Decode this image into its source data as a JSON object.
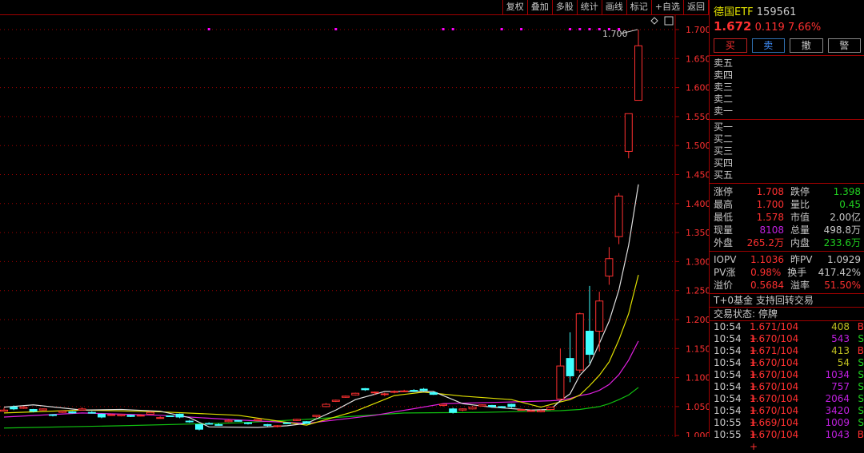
{
  "toolbar": {
    "buttons": [
      "复权",
      "叠加",
      "多股",
      "统计",
      "画线",
      "标记",
      "+自选",
      "返回"
    ]
  },
  "header": {
    "name": "德国ETF",
    "code": "159561",
    "price": "1.672",
    "change": "0.119",
    "pct": "7.66%"
  },
  "actions": [
    "买",
    "卖",
    "撤",
    "警"
  ],
  "sell": [
    "卖五",
    "卖四",
    "卖三",
    "卖二",
    "卖一"
  ],
  "buy": [
    "买一",
    "买二",
    "买三",
    "买四",
    "买五"
  ],
  "stats": [
    {
      "k": "涨停",
      "v": "1.708",
      "vc": "red",
      "k2": "跌停",
      "v2": "1.398",
      "v2c": "grn"
    },
    {
      "k": "最高",
      "v": "1.700",
      "vc": "red",
      "k2": "量比",
      "v2": "0.45",
      "v2c": "grn"
    },
    {
      "k": "最低",
      "v": "1.578",
      "vc": "red",
      "k2": "市值",
      "v2": "2.00亿",
      "v2c": ""
    },
    {
      "k": "现量",
      "v": "8108",
      "vc": "pur",
      "k2": "总量",
      "v2": "498.8万",
      "v2c": ""
    },
    {
      "k": "外盘",
      "v": "265.2万",
      "vc": "red",
      "k2": "内盘",
      "v2": "233.6万",
      "v2c": "grn"
    }
  ],
  "iopv": [
    {
      "k": "IOPV",
      "v": "1.1036",
      "vc": "red",
      "k2": "昨PV",
      "v2": "1.0929",
      "v2c": ""
    },
    {
      "k": "PV涨",
      "v": "0.98%",
      "vc": "red",
      "k2": "换手",
      "v2": "417.42%",
      "v2c": ""
    },
    {
      "k": "溢价",
      "v": "0.5684",
      "vc": "red",
      "k2": "溢率",
      "v2": "51.50%",
      "v2c": "red"
    }
  ],
  "t0": "T+0基金 支持回转交易",
  "status": "交易状态: 停牌",
  "ticks": [
    {
      "t": "10:54",
      "p": "1.671/104 +",
      "v": "408",
      "vc": "yel",
      "s": "B"
    },
    {
      "t": "10:54",
      "p": "1.670/104 +",
      "v": "543",
      "vc": "pur",
      "s": "S"
    },
    {
      "t": "10:54",
      "p": "1.671/104 +",
      "v": "413",
      "vc": "yel",
      "s": "B"
    },
    {
      "t": "10:54",
      "p": "1.670/104 +",
      "v": "54",
      "vc": "yel",
      "s": "S"
    },
    {
      "t": "10:54",
      "p": "1.670/104 +",
      "v": "1034",
      "vc": "pur",
      "s": "S"
    },
    {
      "t": "10:54",
      "p": "1.670/104 +",
      "v": "757",
      "vc": "pur",
      "s": "S"
    },
    {
      "t": "10:54",
      "p": "1.670/104 +",
      "v": "2064",
      "vc": "pur",
      "s": "S"
    },
    {
      "t": "10:54",
      "p": "1.670/104 +",
      "v": "3420",
      "vc": "pur",
      "s": "S"
    },
    {
      "t": "10:55",
      "p": "1.669/104 +",
      "v": "1009",
      "vc": "pur",
      "s": "S"
    },
    {
      "t": "10:55",
      "p": "1.670/104 +",
      "v": "1043",
      "vc": "pur",
      "s": "B"
    }
  ],
  "chart_data": {
    "type": "candlestick",
    "ylim": [
      1.0,
      1.72
    ],
    "yticks": [
      "1.700",
      "1.650",
      "1.600",
      "1.550",
      "1.500",
      "1.450",
      "1.400",
      "1.350",
      "1.300",
      "1.250",
      "1.200",
      "1.150",
      "1.100",
      "1.050",
      "1.000"
    ],
    "high_label": "1.700",
    "colors": {
      "up": "#ff3030",
      "down": "#40ffff",
      "ma5": "#e0e0e0",
      "ma10": "#e0e000",
      "ma20": "#e020e0",
      "ma60": "#10c010",
      "grid": "#a00000",
      "marker": "#ff00ff"
    },
    "ohlc": [
      [
        1.042,
        1.048,
        1.041,
        1.044
      ],
      [
        1.049,
        1.052,
        1.044,
        1.046
      ],
      [
        1.047,
        1.051,
        1.046,
        1.049
      ],
      [
        1.045,
        1.046,
        1.04,
        1.042
      ],
      [
        1.044,
        1.047,
        1.043,
        1.046
      ],
      [
        1.036,
        1.037,
        1.033,
        1.035
      ],
      [
        1.04,
        1.043,
        1.039,
        1.042
      ],
      [
        1.041,
        1.042,
        1.038,
        1.039
      ],
      [
        1.044,
        1.049,
        1.043,
        1.046
      ],
      [
        1.04,
        1.042,
        1.038,
        1.039
      ],
      [
        1.037,
        1.038,
        1.03,
        1.032
      ],
      [
        1.035,
        1.038,
        1.034,
        1.036
      ],
      [
        1.034,
        1.037,
        1.033,
        1.036
      ],
      [
        1.035,
        1.036,
        1.032,
        1.033
      ],
      [
        1.034,
        1.037,
        1.033,
        1.035
      ],
      [
        1.037,
        1.042,
        1.036,
        1.04
      ],
      [
        1.031,
        1.033,
        1.029,
        1.031
      ],
      [
        1.034,
        1.035,
        1.032,
        1.033
      ],
      [
        1.037,
        1.038,
        1.03,
        1.032
      ],
      [
        1.025,
        1.027,
        1.022,
        1.024
      ],
      [
        1.019,
        1.02,
        1.009,
        1.011
      ],
      [
        1.021,
        1.023,
        1.019,
        1.02
      ],
      [
        1.019,
        1.021,
        1.017,
        1.018
      ],
      [
        1.024,
        1.028,
        1.023,
        1.026
      ],
      [
        1.026,
        1.027,
        1.024,
        1.025
      ],
      [
        1.022,
        1.023,
        1.019,
        1.021
      ],
      [
        1.026,
        1.029,
        1.025,
        1.028
      ],
      [
        1.019,
        1.02,
        1.016,
        1.018
      ],
      [
        1.016,
        1.018,
        1.014,
        1.017
      ],
      [
        1.022,
        1.023,
        1.02,
        1.021
      ],
      [
        1.026,
        1.029,
        1.025,
        1.028
      ],
      [
        1.024,
        1.025,
        1.02,
        1.021
      ],
      [
        1.033,
        1.035,
        1.031,
        1.035
      ],
      [
        1.05,
        1.056,
        1.049,
        1.054
      ],
      [
        1.059,
        1.062,
        1.058,
        1.061
      ],
      [
        1.066,
        1.069,
        1.065,
        1.068
      ],
      [
        1.07,
        1.074,
        1.069,
        1.073
      ],
      [
        1.081,
        1.082,
        1.077,
        1.079
      ],
      [
        1.074,
        1.076,
        1.07,
        1.075
      ],
      [
        1.071,
        1.074,
        1.068,
        1.072
      ],
      [
        1.075,
        1.078,
        1.073,
        1.076
      ],
      [
        1.076,
        1.079,
        1.075,
        1.077
      ],
      [
        1.078,
        1.08,
        1.075,
        1.077
      ],
      [
        1.08,
        1.082,
        1.076,
        1.078
      ],
      [
        1.074,
        1.076,
        1.07,
        1.071
      ],
      [
        1.052,
        1.055,
        1.05,
        1.054
      ],
      [
        1.046,
        1.048,
        1.038,
        1.04
      ],
      [
        1.044,
        1.047,
        1.042,
        1.046
      ],
      [
        1.046,
        1.051,
        1.045,
        1.049
      ],
      [
        1.051,
        1.054,
        1.05,
        1.053
      ],
      [
        1.052,
        1.053,
        1.048,
        1.05
      ],
      [
        1.05,
        1.051,
        1.047,
        1.049
      ],
      [
        1.054,
        1.055,
        1.048,
        1.05
      ],
      [
        1.044,
        1.046,
        1.043,
        1.045
      ],
      [
        1.042,
        1.045,
        1.041,
        1.043
      ],
      [
        1.041,
        1.045,
        1.04,
        1.043
      ],
      [
        1.045,
        1.05,
        1.044,
        1.049
      ],
      [
        1.063,
        1.15,
        1.06,
        1.12
      ],
      [
        1.133,
        1.178,
        1.092,
        1.103
      ],
      [
        1.113,
        1.212,
        1.108,
        1.21
      ],
      [
        1.18,
        1.258,
        1.125,
        1.14
      ],
      [
        1.18,
        1.248,
        1.145,
        1.232
      ],
      [
        1.275,
        1.325,
        1.26,
        1.305
      ],
      [
        1.343,
        1.418,
        1.33,
        1.413
      ],
      [
        1.49,
        1.555,
        1.478,
        1.555
      ],
      [
        1.578,
        1.7,
        1.578,
        1.672
      ]
    ],
    "ma": {
      "ma5": [
        [
          0,
          1.049
        ],
        [
          3,
          1.053
        ],
        [
          8,
          1.044
        ],
        [
          12,
          1.045
        ],
        [
          16,
          1.042
        ],
        [
          19,
          1.031
        ],
        [
          21,
          1.015
        ],
        [
          26,
          1.014
        ],
        [
          29,
          1.017
        ],
        [
          31,
          1.021
        ],
        [
          34,
          1.044
        ],
        [
          36,
          1.062
        ],
        [
          39,
          1.076
        ],
        [
          44,
          1.076
        ],
        [
          47,
          1.055
        ],
        [
          50,
          1.049
        ],
        [
          54,
          1.044
        ],
        [
          56,
          1.045
        ],
        [
          57,
          1.06
        ],
        [
          58,
          1.072
        ],
        [
          59,
          1.104
        ],
        [
          60,
          1.122
        ],
        [
          61,
          1.159
        ],
        [
          62,
          1.197
        ],
        [
          63,
          1.251
        ],
        [
          64,
          1.328
        ],
        [
          65,
          1.433
        ]
      ],
      "ma10": [
        [
          0,
          1.039
        ],
        [
          8,
          1.044
        ],
        [
          16,
          1.041
        ],
        [
          24,
          1.035
        ],
        [
          31,
          1.018
        ],
        [
          36,
          1.042
        ],
        [
          40,
          1.069
        ],
        [
          43,
          1.075
        ],
        [
          47,
          1.068
        ],
        [
          52,
          1.062
        ],
        [
          55,
          1.049
        ],
        [
          57,
          1.058
        ],
        [
          58,
          1.062
        ],
        [
          59,
          1.07
        ],
        [
          60,
          1.086
        ],
        [
          61,
          1.104
        ],
        [
          62,
          1.127
        ],
        [
          63,
          1.165
        ],
        [
          64,
          1.21
        ],
        [
          65,
          1.277
        ]
      ],
      "ma20": [
        [
          0,
          1.032
        ],
        [
          8,
          1.039
        ],
        [
          16,
          1.035
        ],
        [
          24,
          1.027
        ],
        [
          31,
          1.021
        ],
        [
          38,
          1.035
        ],
        [
          45,
          1.055
        ],
        [
          52,
          1.058
        ],
        [
          56,
          1.06
        ],
        [
          57,
          1.061
        ],
        [
          58,
          1.064
        ],
        [
          59,
          1.069
        ],
        [
          60,
          1.072
        ],
        [
          61,
          1.078
        ],
        [
          62,
          1.088
        ],
        [
          63,
          1.105
        ],
        [
          64,
          1.13
        ],
        [
          65,
          1.163
        ]
      ],
      "ma60": [
        [
          0,
          1.013
        ],
        [
          12,
          1.017
        ],
        [
          24,
          1.022
        ],
        [
          31,
          1.028
        ],
        [
          41,
          1.039
        ],
        [
          49,
          1.04
        ],
        [
          57,
          1.043
        ],
        [
          59,
          1.045
        ],
        [
          61,
          1.05
        ],
        [
          62,
          1.055
        ],
        [
          63,
          1.062
        ],
        [
          64,
          1.07
        ],
        [
          65,
          1.083
        ]
      ]
    },
    "marker_indices": [
      21,
      34,
      45,
      46,
      51,
      53,
      58,
      59,
      60,
      61,
      62,
      63
    ]
  }
}
